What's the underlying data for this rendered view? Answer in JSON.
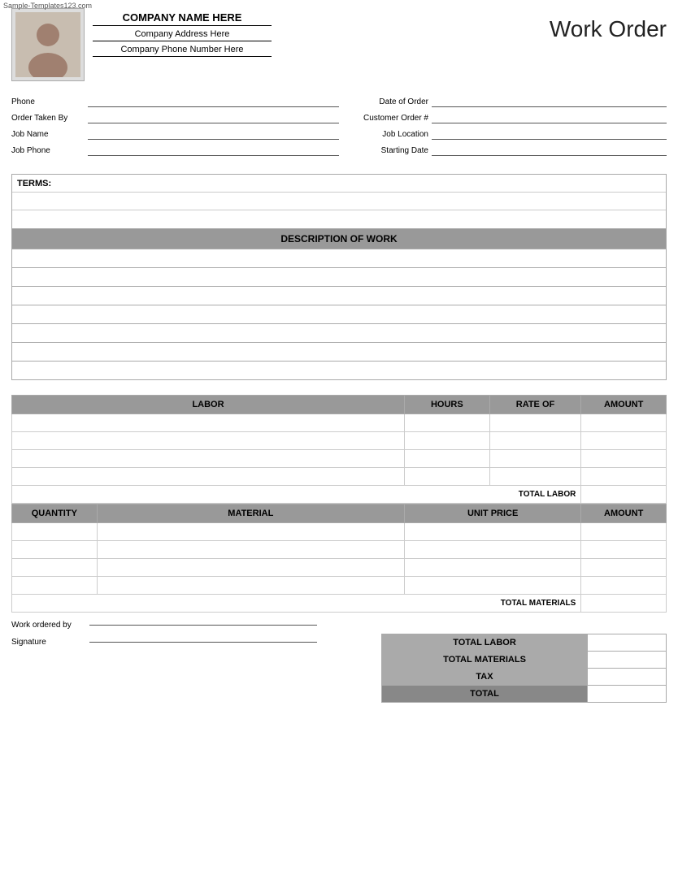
{
  "watermark": "Sample-Templates123.com",
  "header": {
    "company_name": "COMPANY NAME HERE",
    "company_address": "Company Address Here",
    "company_phone": "Company Phone Number Here",
    "title": "Work Order"
  },
  "form": {
    "left": [
      {
        "label": "Phone",
        "value": ""
      },
      {
        "label": "Order Taken By",
        "value": ""
      },
      {
        "label": "Job Name",
        "value": ""
      },
      {
        "label": "Job Phone",
        "value": ""
      }
    ],
    "right": [
      {
        "label": "Date of Order",
        "value": ""
      },
      {
        "label": "Customer Order #",
        "value": ""
      },
      {
        "label": "Job Location",
        "value": ""
      },
      {
        "label": "Starting Date",
        "value": ""
      }
    ]
  },
  "terms": {
    "label": "TERMS:",
    "rows": 3
  },
  "description": {
    "header": "DESCRIPTION OF WORK",
    "rows": 7
  },
  "labor_table": {
    "columns": [
      "LABOR",
      "HOURS",
      "RATE OF",
      "AMOUNT"
    ],
    "rows": 4,
    "total_label": "TOTAL LABOR"
  },
  "materials_table": {
    "columns": [
      "QUANTITY",
      "MATERIAL",
      "UNIT PRICE",
      "AMOUNT"
    ],
    "rows": 4,
    "total_label": "TOTAL MATERIALS"
  },
  "summary": {
    "rows": [
      {
        "label": "TOTAL LABOR",
        "value": ""
      },
      {
        "label": "TOTAL MATERIALS",
        "value": ""
      },
      {
        "label": "TAX",
        "value": ""
      },
      {
        "label": "TOTAL",
        "value": ""
      }
    ]
  },
  "signature": {
    "work_ordered_by_label": "Work ordered by",
    "signature_label": "Signature"
  }
}
